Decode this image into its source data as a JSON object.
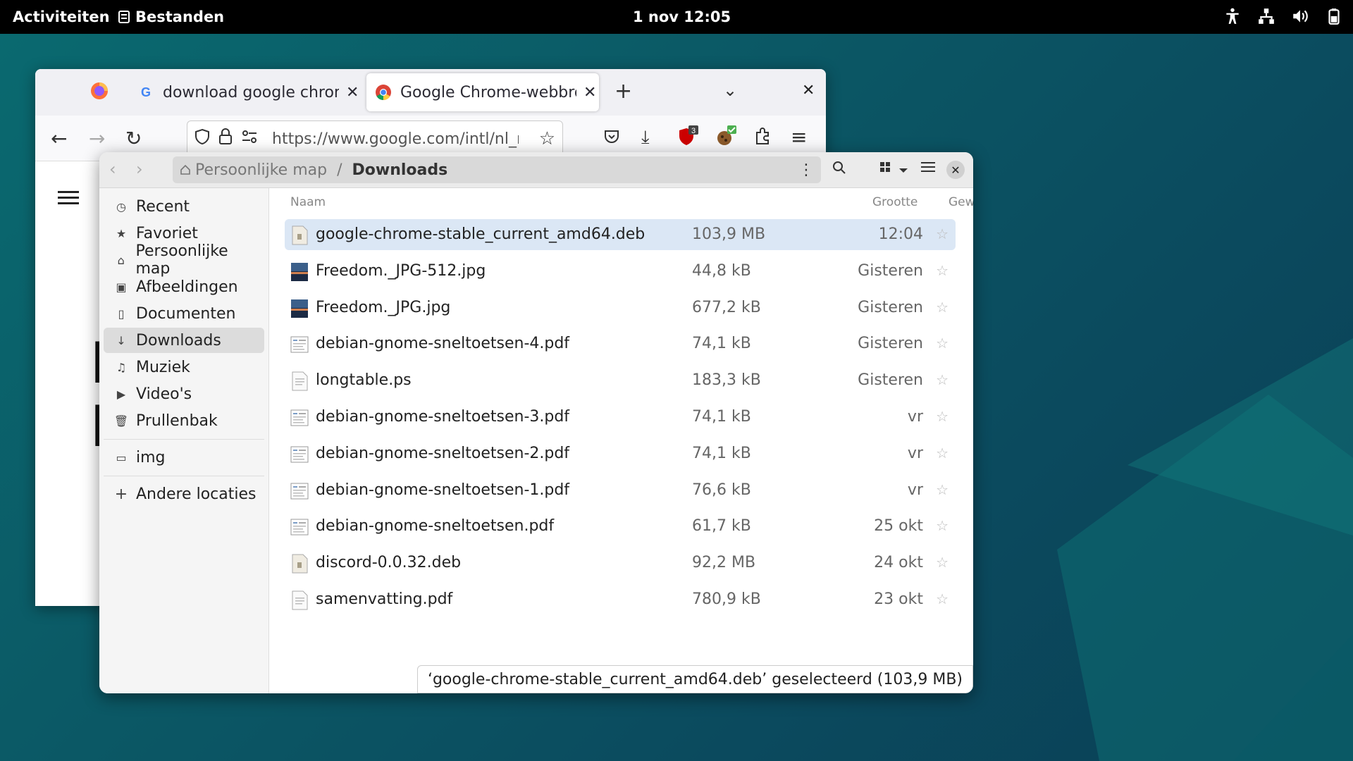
{
  "topbar": {
    "activities": "Activiteiten",
    "app_name": "Bestanden",
    "clock": "1 nov  12:05",
    "tray_icons": [
      "accessibility-icon",
      "network-icon",
      "volume-icon",
      "battery-icon"
    ]
  },
  "browser": {
    "tabs": [
      {
        "title": "download google chrome",
        "favicon": "google-icon"
      },
      {
        "title": "Google Chrome-webbrowser",
        "favicon": "chrome-icon",
        "active": true
      }
    ],
    "url": "https://www.google.com/intl/nl_nl",
    "extension_badge": "3",
    "page_letters": [
      "E",
      "M"
    ]
  },
  "files": {
    "path_home": "Persoonlijke map",
    "path_current": "Downloads",
    "sidebar": [
      {
        "label": "Recent",
        "icon": "clock-icon"
      },
      {
        "label": "Favoriet",
        "icon": "star-icon"
      },
      {
        "label": "Persoonlijke map",
        "icon": "home-icon"
      },
      {
        "label": "Afbeeldingen",
        "icon": "image-icon"
      },
      {
        "label": "Documenten",
        "icon": "document-icon"
      },
      {
        "label": "Downloads",
        "icon": "download-icon",
        "active": true
      },
      {
        "label": "Muziek",
        "icon": "music-icon"
      },
      {
        "label": "Video's",
        "icon": "video-icon"
      },
      {
        "label": "Prullenbak",
        "icon": "trash-icon"
      },
      {
        "label": "img",
        "icon": "folder-icon"
      },
      {
        "label": "Andere locaties",
        "icon": "plus-icon"
      }
    ],
    "columns": {
      "name": "Naam",
      "size": "Grootte",
      "modified": "Gewijzigd"
    },
    "files": [
      {
        "name": "google-chrome-stable_current_amd64.deb",
        "size": "103,9 MB",
        "modified": "12:04",
        "type": "package",
        "selected": true
      },
      {
        "name": "Freedom._JPG-512.jpg",
        "size": "44,8 kB",
        "modified": "Gisteren",
        "type": "image"
      },
      {
        "name": "Freedom._JPG.jpg",
        "size": "677,2 kB",
        "modified": "Gisteren",
        "type": "image"
      },
      {
        "name": "debian-gnome-sneltoetsen-4.pdf",
        "size": "74,1 kB",
        "modified": "Gisteren",
        "type": "pdf"
      },
      {
        "name": "longtable.ps",
        "size": "183,3 kB",
        "modified": "Gisteren",
        "type": "doc"
      },
      {
        "name": "debian-gnome-sneltoetsen-3.pdf",
        "size": "74,1 kB",
        "modified": "vr",
        "type": "pdf"
      },
      {
        "name": "debian-gnome-sneltoetsen-2.pdf",
        "size": "74,1 kB",
        "modified": "vr",
        "type": "pdf"
      },
      {
        "name": "debian-gnome-sneltoetsen-1.pdf",
        "size": "76,6 kB",
        "modified": "vr",
        "type": "pdf"
      },
      {
        "name": "debian-gnome-sneltoetsen.pdf",
        "size": "61,7 kB",
        "modified": "25 okt",
        "type": "pdf"
      },
      {
        "name": "discord-0.0.32.deb",
        "size": "92,2 MB",
        "modified": "24 okt",
        "type": "package"
      },
      {
        "name": "samenvatting.pdf",
        "size": "780,9 kB",
        "modified": "23 okt",
        "type": "doc"
      }
    ],
    "status": "‘google-chrome-stable_current_amd64.deb’ geselecteerd (103,9 MB)"
  },
  "colors": {
    "accent": "#3584e4",
    "selection": "#dbe7f5",
    "topbar": "#000000"
  }
}
